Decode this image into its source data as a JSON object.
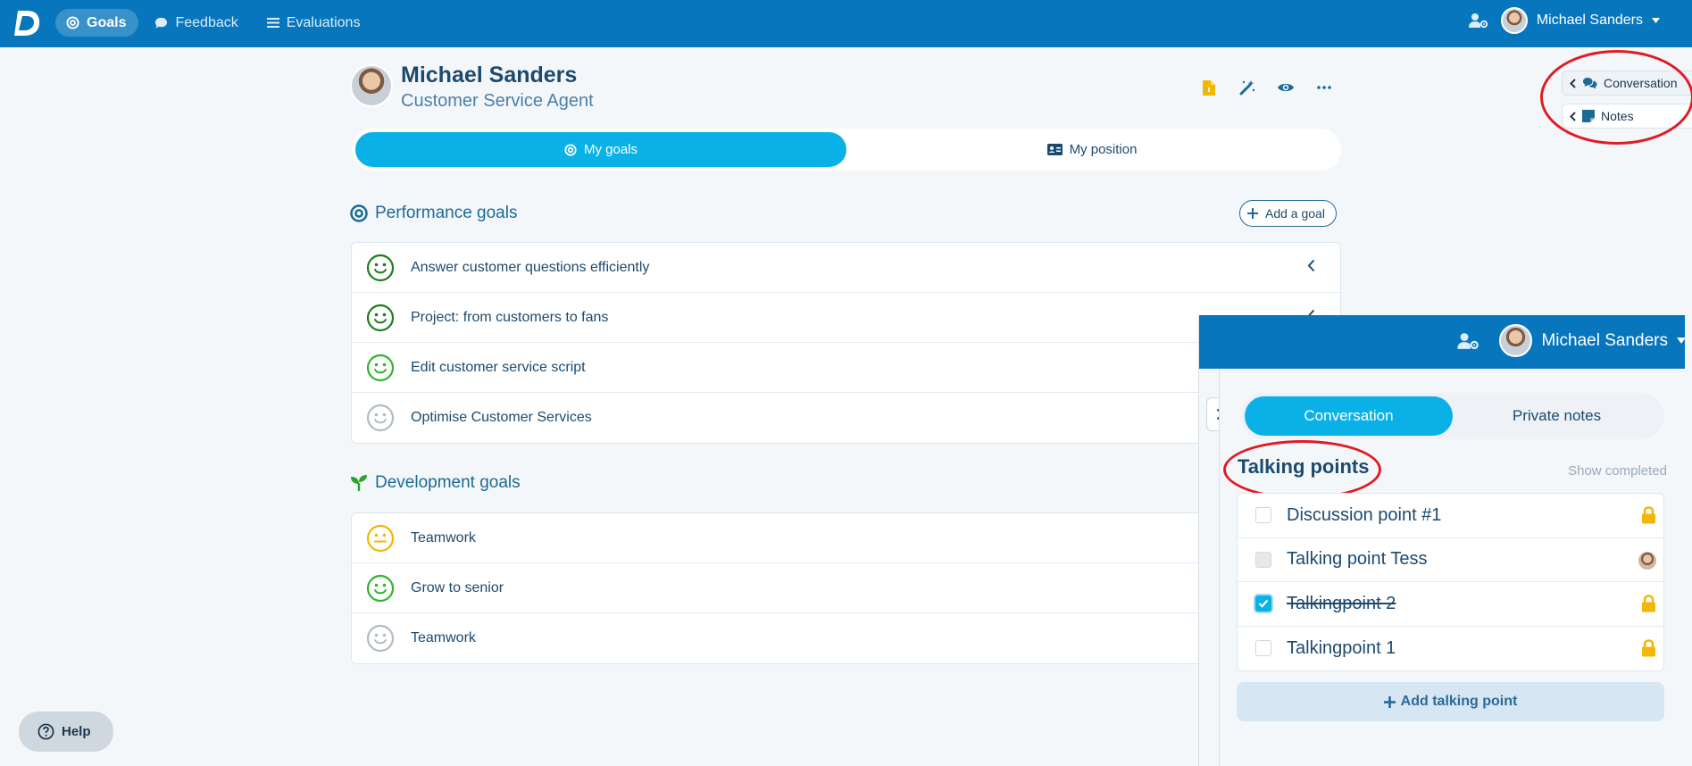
{
  "topbar": {
    "logo_letter": "D",
    "nav": [
      {
        "label": "Goals",
        "icon": "target-icon",
        "active": true
      },
      {
        "label": "Feedback",
        "icon": "chat-bubble-icon",
        "active": false
      },
      {
        "label": "Evaluations",
        "icon": "list-icon",
        "active": false
      }
    ],
    "user_name": "Michael Sanders"
  },
  "profile": {
    "name": "Michael Sanders",
    "role": "Customer Service Agent",
    "tools": [
      "document-icon",
      "magic-wand-icon",
      "eye-icon",
      "more-icon"
    ]
  },
  "tabs": {
    "my_goals": "My goals",
    "my_position": "My position"
  },
  "performance": {
    "title": "Performance goals",
    "add_label": "Add a goal",
    "goals": [
      {
        "label": "Answer customer questions efficiently",
        "mood": "happy",
        "color": "#1e7e1e"
      },
      {
        "label": "Project: from customers to fans",
        "mood": "happy",
        "color": "#1e7e1e"
      },
      {
        "label": "Edit customer service script",
        "mood": "happy",
        "color": "#31b52e"
      },
      {
        "label": "Optimise Customer Services",
        "mood": "happy",
        "color": "#b3bcc4"
      }
    ]
  },
  "development": {
    "title": "Development goals",
    "goals": [
      {
        "label": "Teamwork",
        "mood": "neutral",
        "color": "#f2b705"
      },
      {
        "label": "Grow to senior",
        "mood": "happy",
        "color": "#31b52e"
      },
      {
        "label": "Teamwork",
        "mood": "happy",
        "color": "#b3bcc4"
      }
    ]
  },
  "side_buttons": {
    "conversation": "Conversation",
    "notes": "Notes"
  },
  "help": {
    "label": "Help"
  },
  "panel": {
    "user_name": "Michael Sanders",
    "tabs": {
      "conversation": "Conversation",
      "private_notes": "Private notes"
    },
    "title": "Talking points",
    "show_completed": "Show completed",
    "points": [
      {
        "label": "Discussion point #1",
        "state": "unchecked",
        "marker": "lock"
      },
      {
        "label": "Talking point Tess",
        "state": "disabled",
        "marker": "avatar"
      },
      {
        "label": "Talkingpoint 2",
        "state": "checked",
        "marker": "lock"
      },
      {
        "label": "Talkingpoint 1",
        "state": "unchecked",
        "marker": "lock"
      }
    ],
    "add_label": "Add talking point"
  },
  "colors": {
    "brand": "#0876bd",
    "accent": "#0ab1e6",
    "highlight": "#e01b24",
    "lock": "#f2b705"
  }
}
